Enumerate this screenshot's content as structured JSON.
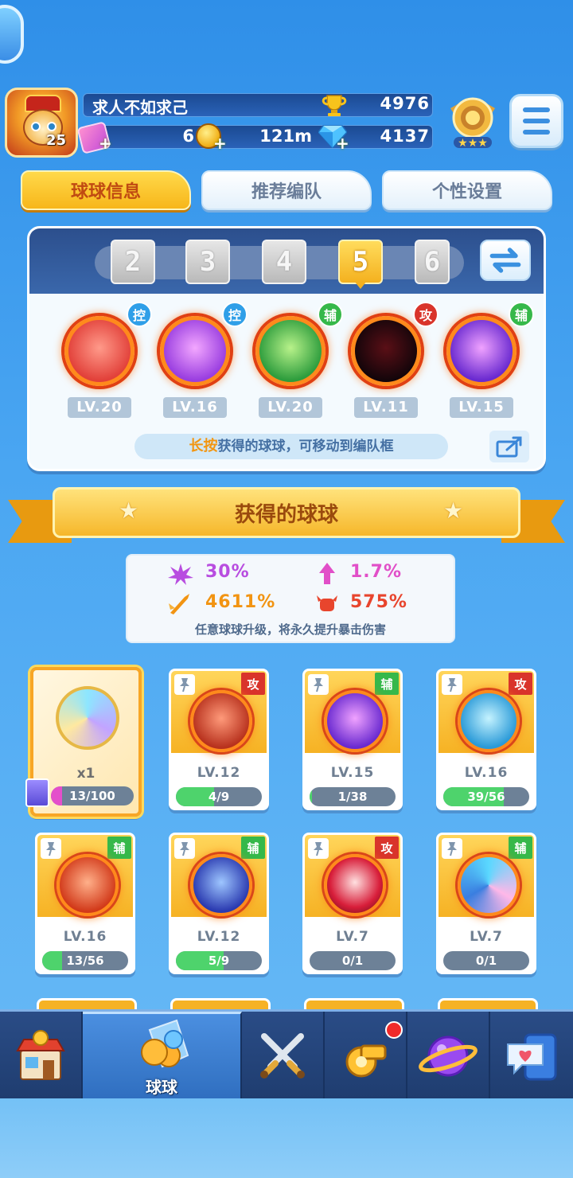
{
  "player": {
    "name": "求人不如求己",
    "level": "25",
    "trophies": "4976",
    "tickets": "6",
    "coins": "121m",
    "gems": "4137"
  },
  "tabs": [
    {
      "label": "球球信息",
      "active": true
    },
    {
      "label": "推荐编队",
      "active": false
    },
    {
      "label": "个性设置",
      "active": false
    }
  ],
  "team": {
    "slots": [
      "2",
      "3",
      "4",
      "5",
      "6"
    ],
    "selected_slot": "5",
    "members": [
      {
        "role": "控",
        "level": "LV.20",
        "icon": "gorilla-ball-icon"
      },
      {
        "role": "控",
        "level": "LV.16",
        "icon": "butterfly-ball-icon"
      },
      {
        "role": "辅",
        "level": "LV.20",
        "icon": "green-crystal-ball-icon"
      },
      {
        "role": "攻",
        "level": "LV.11",
        "icon": "venom-ball-icon"
      },
      {
        "role": "辅",
        "level": "LV.15",
        "icon": "lightning-ball-icon"
      }
    ],
    "hint_highlight": "长按",
    "hint_rest": "获得的球球，可移动到编队框"
  },
  "collection": {
    "title": "获得的球球",
    "stats": [
      {
        "value": "30%",
        "color": "#b84de0",
        "icon": "purple-burst-icon"
      },
      {
        "value": "1.7%",
        "color": "#e14fc8",
        "icon": "pink-arrow-icon"
      },
      {
        "value": "4611%",
        "color": "#f29412",
        "icon": "crit-sword-icon"
      },
      {
        "value": "575%",
        "color": "#e8452d",
        "icon": "red-fist-icon"
      }
    ],
    "stats_note": "任意球球升级，将永久提升暴击伤害",
    "special": {
      "qty": "x1",
      "progress": "13/100",
      "fraction": 0.13
    },
    "cards": [
      {
        "role": "攻",
        "level": "LV.12",
        "progress": "4/9",
        "fraction": 0.44,
        "icon": "infinity-ball-icon"
      },
      {
        "role": "辅",
        "level": "LV.15",
        "progress": "1/38",
        "fraction": 0.03,
        "icon": "lightning-ball-icon"
      },
      {
        "role": "攻",
        "level": "LV.16",
        "progress": "39/56",
        "fraction": 0.7,
        "icon": "ice-pillar-ball-icon"
      },
      {
        "role": "辅",
        "level": "LV.16",
        "progress": "13/56",
        "fraction": 0.23,
        "icon": "wings-ball-icon"
      },
      {
        "role": "辅",
        "level": "LV.12",
        "progress": "5/9",
        "fraction": 0.56,
        "icon": "hex-shield-ball-icon"
      },
      {
        "role": "攻",
        "level": "LV.7",
        "progress": "0/1",
        "fraction": 0.0,
        "icon": "red-energy-ball-icon"
      },
      {
        "role": "辅",
        "level": "LV.7",
        "progress": "0/1",
        "fraction": 0.0,
        "icon": "swirl-ball-icon"
      }
    ]
  },
  "nav": {
    "items": [
      {
        "icon": "shop-icon",
        "label": ""
      },
      {
        "icon": "balls-icon",
        "label": "球球",
        "active": true
      },
      {
        "icon": "crossed-swords-icon",
        "label": ""
      },
      {
        "icon": "whistle-icon",
        "label": "",
        "badge": true
      },
      {
        "icon": "planet-icon",
        "label": ""
      },
      {
        "icon": "chat-heart-icon",
        "label": ""
      }
    ]
  }
}
